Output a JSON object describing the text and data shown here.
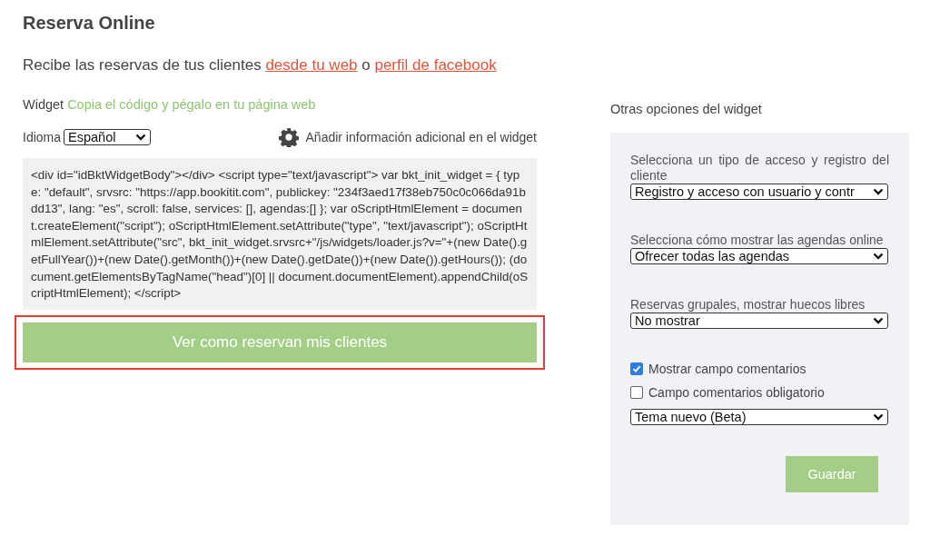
{
  "title": "Reserva Online",
  "intro": {
    "text": "Recibe las reservas de tus clientes",
    "link1": "desde tu web",
    "joiner": "o",
    "link2": "perfil de facebook"
  },
  "widget": {
    "label": "Widget",
    "hint": "Copia el código y pégalo en tu página web",
    "language_label": "Idioma",
    "language": "Español",
    "extra_info": "Añadir información adicional en el widget",
    "code": "<div id=\"idBktWidgetBody\"></div> <script type=\"text/javascript\"> var bkt_init_widget = { type: \"default\", srvsrc: \"https://app.bookitit.com\", publickey: \"234f3aed17f38eb750c0c066da91bdd13\", lang: \"es\", scroll: false, services: [], agendas:[] }; var oScriptHtmlElement = document.createElement(\"script\"); oScriptHtmlElement.setAttribute(\"type\", \"text/javascript\"); oScriptHtmlElement.setAttribute(\"src\", bkt_init_widget.srvsrc+\"/js/widgets/loader.js?v=\"+(new Date().getFullYear())+(new Date().getMonth())+(new Date().getDate())+(new Date()).getHours()); (document.getElementsByTagName(\"head\")[0] || document.documentElement).appendChild(oScriptHtmlElement); </script>",
    "preview_button": {
      "label": "Ver como reservan mis clientes",
      "highlighted": true
    }
  },
  "options": {
    "title": "Otras opciones del widget",
    "items": [
      {
        "kind": "select",
        "label": "Selecciona un tipo de acceso y registro del cliente",
        "value": "Registro y acceso con usuario y contr"
      },
      {
        "kind": "select",
        "label": "Selecciona cómo mostrar las agendas online",
        "value": "Ofrecer todas las agendas"
      },
      {
        "kind": "select",
        "label": "Reservas grupales, mostrar huecos libres",
        "value": "No mostrar"
      },
      {
        "kind": "checkbox",
        "label": "Mostrar campo comentarios",
        "checked": true
      },
      {
        "kind": "checkbox",
        "label": "Campo comentarios obligatorio",
        "checked": false
      },
      {
        "kind": "select",
        "value": "Tema nuevo (Beta)"
      }
    ],
    "save_button": "Guardar"
  }
}
